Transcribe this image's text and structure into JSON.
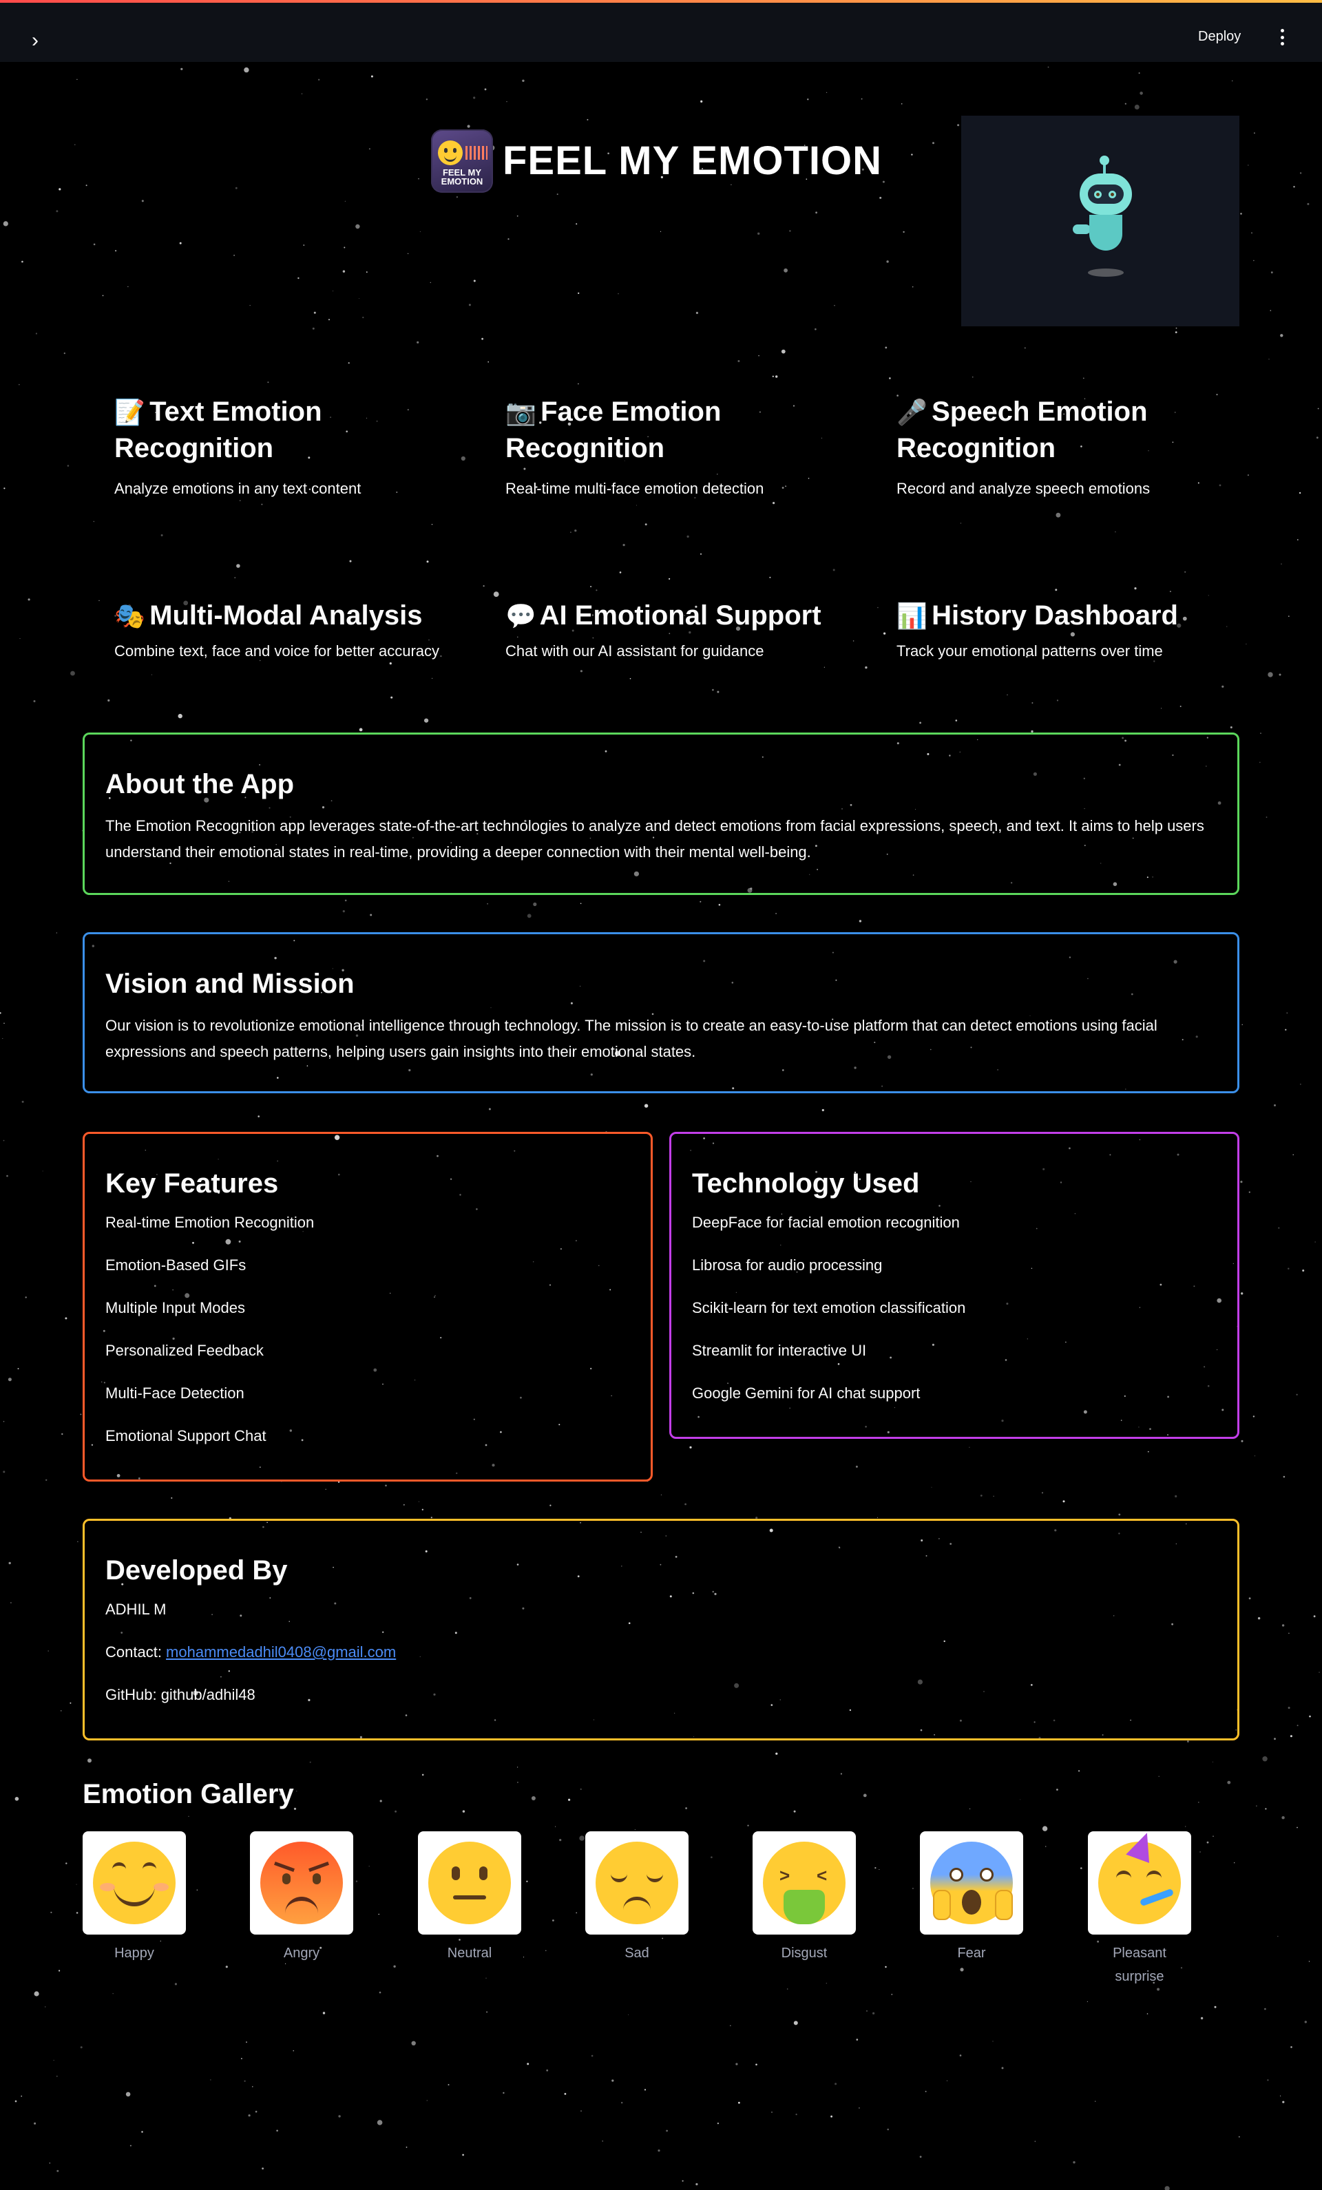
{
  "header": {
    "deploy_label": "Deploy",
    "expand_icon": "chevron-right-icon",
    "menu_icon": "vertical-ellipsis-icon"
  },
  "hero": {
    "logo_text": "FEEL MY EMOTION",
    "title": "FEEL MY EMOTION"
  },
  "features": [
    {
      "icon": "📝",
      "title": "Text Emotion Recognition",
      "desc": "Analyze emotions in any text content"
    },
    {
      "icon": "📷",
      "title": "Face Emotion Recognition",
      "desc": "Real-time multi-face emotion detection"
    },
    {
      "icon": "🎤",
      "title": "Speech Emotion Recognition",
      "desc": "Record and analyze speech emotions"
    },
    {
      "icon": "🎭",
      "title": "Multi-Modal Analysis",
      "desc": "Combine text, face and voice for better accuracy"
    },
    {
      "icon": "💬",
      "title": "AI Emotional Support",
      "desc": "Chat with our AI assistant for guidance"
    },
    {
      "icon": "📊",
      "title": "History Dashboard",
      "desc": "Track your emotional patterns over time"
    }
  ],
  "about": {
    "title": "About the App",
    "text": "The Emotion Recognition app leverages state-of-the-art technologies to analyze and detect emotions from facial expressions, speech, and text. It aims to help users understand their emotional states in real-time, providing a deeper connection with their mental well-being."
  },
  "vision": {
    "title": "Vision and Mission",
    "text": "Our vision is to revolutionize emotional intelligence through technology. The mission is to create an easy-to-use platform that can detect emotions using facial expressions and speech patterns, helping users gain insights into their emotional states."
  },
  "key_features": {
    "title": "Key Features",
    "items": [
      "Real-time Emotion Recognition",
      "Emotion-Based GIFs",
      "Multiple Input Modes",
      "Personalized Feedback",
      "Multi-Face Detection",
      "Emotional Support Chat"
    ]
  },
  "technology": {
    "title": "Technology Used",
    "items": [
      "DeepFace for facial emotion recognition",
      "Librosa for audio processing",
      "Scikit-learn for text emotion classification",
      "Streamlit for interactive UI",
      "Google Gemini for AI chat support"
    ]
  },
  "developer": {
    "title": "Developed By",
    "name": "ADHIL M",
    "contact_label": "Contact: ",
    "email": "mohammedadhil0408@gmail.com",
    "github": "GitHub: github/adhil48"
  },
  "gallery": {
    "title": "Emotion Gallery",
    "items": [
      {
        "label": "Happy",
        "color": "#ffcc33"
      },
      {
        "label": "Angry",
        "color": "#ff7a33"
      },
      {
        "label": "Neutral",
        "color": "#ffcc33"
      },
      {
        "label": "Sad",
        "color": "#ffcc33"
      },
      {
        "label": "Disgust",
        "color": "#ffcc33"
      },
      {
        "label": "Fear",
        "color": "#ffcc33"
      },
      {
        "label": "Pleasant surprise",
        "color": "#ffcc33"
      }
    ]
  },
  "colors": {
    "about_border": "#5bd65b",
    "vision_border": "#3b8fe8",
    "key_border": "#ff5a2a",
    "tech_border": "#c23ee8",
    "dev_border": "#ffbf2a",
    "link": "#4b8bf5"
  }
}
